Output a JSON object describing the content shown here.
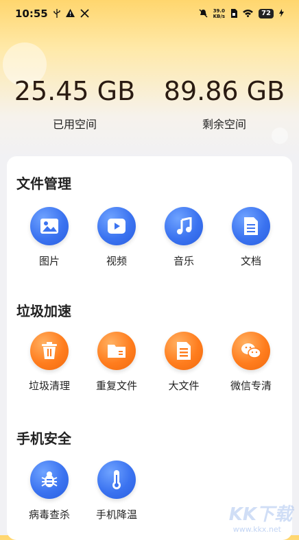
{
  "status_bar": {
    "time": "10:55",
    "left_icons": [
      "usb-icon",
      "warning-icon",
      "tools-icon"
    ],
    "net_speed_value": "39.0",
    "net_speed_unit": "KB/s",
    "battery": "72"
  },
  "storage": {
    "used_value": "25.45 GB",
    "used_label": "已用空间",
    "free_value": "89.86 GB",
    "free_label": "剩余空间"
  },
  "sections": {
    "files": {
      "title": "文件管理",
      "items": [
        {
          "label": "图片",
          "icon": "image-icon"
        },
        {
          "label": "视频",
          "icon": "video-icon"
        },
        {
          "label": "音乐",
          "icon": "music-icon"
        },
        {
          "label": "文档",
          "icon": "document-icon"
        }
      ]
    },
    "junk": {
      "title": "垃圾加速",
      "items": [
        {
          "label": "垃圾清理",
          "icon": "trash-icon"
        },
        {
          "label": "重复文件",
          "icon": "folder-icon"
        },
        {
          "label": "大文件",
          "icon": "large-file-icon"
        },
        {
          "label": "微信专清",
          "icon": "wechat-icon"
        }
      ]
    },
    "security": {
      "title": "手机安全",
      "items": [
        {
          "label": "病毒查杀",
          "icon": "bug-icon"
        },
        {
          "label": "手机降温",
          "icon": "thermometer-icon"
        }
      ]
    }
  },
  "colors": {
    "blue_accent": "#3b73f0",
    "orange_accent": "#ff7d1e",
    "header_yellow": "#ffd66e"
  },
  "watermark": {
    "text": "KK下载",
    "url": "www.kkx.net"
  }
}
